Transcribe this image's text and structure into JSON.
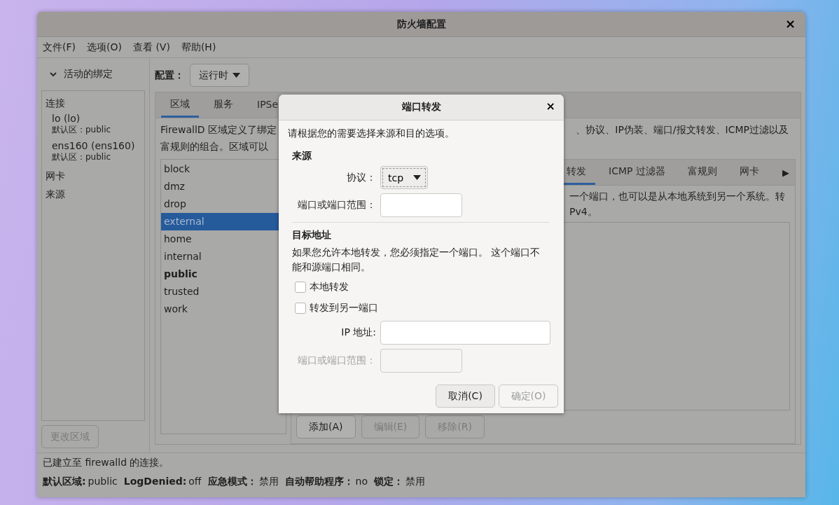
{
  "window": {
    "title": "防火墙配置",
    "close": "×"
  },
  "menu": [
    "文件(F)",
    "选项(O)",
    "查看 (V)",
    "帮助(H)"
  ],
  "sidebar": {
    "header": "活动的绑定",
    "expanded": true,
    "sections": [
      {
        "label": "连接",
        "items": [
          {
            "name": "lo (lo)",
            "zone": "默认区：public"
          },
          {
            "name": "ens160 (ens160)",
            "zone": "默认区：public"
          }
        ]
      },
      {
        "label": "网卡"
      },
      {
        "label": "来源"
      }
    ],
    "button": {
      "label": "更改区域",
      "disabled": true
    }
  },
  "config": {
    "label": "配置：",
    "value": "运行时"
  },
  "tabs": [
    {
      "label": "区域",
      "selected": true
    },
    {
      "label": "服务",
      "selected": false
    },
    {
      "label": "IPSe",
      "selected": false
    }
  ],
  "description": {
    "left": [
      "FirewallD 区域定义了绑定",
      "富规则的组合。区域可以"
    ],
    "right": "、协议、IP伪装、端口/报文转发、ICMP过滤以及"
  },
  "zones": [
    {
      "name": "block",
      "selected": false,
      "default": false
    },
    {
      "name": "dmz",
      "selected": false,
      "default": false
    },
    {
      "name": "drop",
      "selected": false,
      "default": false
    },
    {
      "name": "external",
      "selected": true,
      "default": false
    },
    {
      "name": "home",
      "selected": false,
      "default": false
    },
    {
      "name": "internal",
      "selected": false,
      "default": false
    },
    {
      "name": "public",
      "selected": false,
      "default": true
    },
    {
      "name": "trusted",
      "selected": false,
      "default": false
    },
    {
      "name": "work",
      "selected": false,
      "default": false
    }
  ],
  "zone_tabs": [
    {
      "label": "转发",
      "selected": true
    },
    {
      "label": "ICMP 过滤器",
      "selected": false
    },
    {
      "label": "富规则",
      "selected": false
    },
    {
      "label": "网卡",
      "selected": false
    }
  ],
  "zone_tabs_more": "▶",
  "zone_description": [
    "一个端口，也可以是从本地系统到另一个系统。转",
    "Pv4。"
  ],
  "actions": [
    {
      "label": "添加(A)",
      "disabled": false
    },
    {
      "label": "编辑(E)",
      "disabled": true
    },
    {
      "label": "移除(R)",
      "disabled": true
    }
  ],
  "status": {
    "message": "已建立至 firewalld 的连接。",
    "items": [
      {
        "label": "默认区域:",
        "value": "public"
      },
      {
        "label": "LogDenied:",
        "value": "off"
      },
      {
        "label": "应急模式：",
        "value": "禁用"
      },
      {
        "label": "自动帮助程序：",
        "value": "no"
      },
      {
        "label": "锁定：",
        "value": "禁用"
      }
    ]
  },
  "dialog": {
    "title": "端口转发",
    "close": "×",
    "intro": "请根据您的需要选择来源和目的选项。",
    "source": {
      "heading": "来源",
      "protocol_label": "协议：",
      "protocol": "tcp",
      "port_label": "端口或端口范围："
    },
    "destination": {
      "heading": "目标地址",
      "note": "如果您允许本地转发，您必须指定一个端口。 这个端口不能和源端口相同。",
      "checks": [
        {
          "label": "本地转发",
          "checked": false
        },
        {
          "label": "转发到另一端口",
          "checked": false
        }
      ],
      "ip_label": "IP 地址:",
      "port_label": "端口或端口范围：",
      "port_disabled": true
    },
    "buttons": [
      {
        "label": "取消(C)",
        "disabled": false
      },
      {
        "label": "确定(O)",
        "disabled": true
      }
    ]
  }
}
